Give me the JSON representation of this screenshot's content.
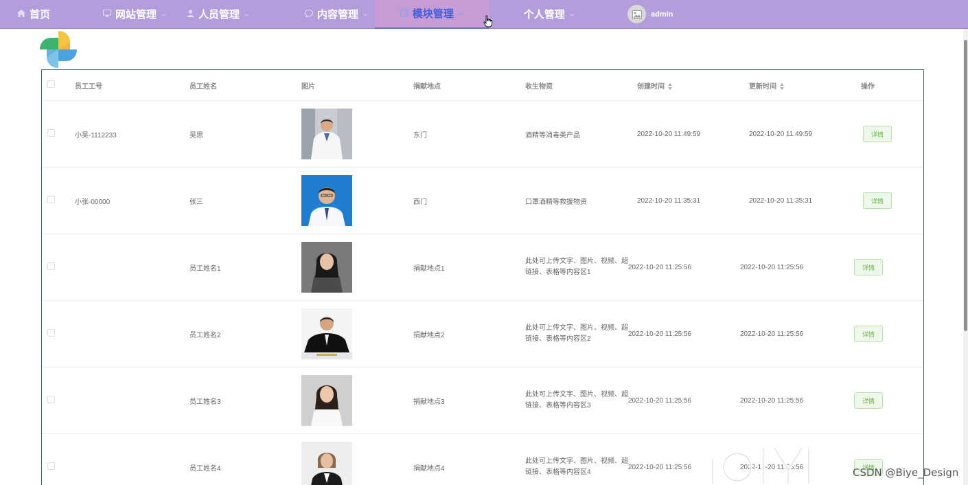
{
  "nav": {
    "items": [
      {
        "label": "首页",
        "icon": "home-icon",
        "dropdown": false
      },
      {
        "label": "网站管理",
        "icon": "monitor-icon",
        "dropdown": true
      },
      {
        "label": "人员管理",
        "icon": "user-icon",
        "dropdown": true
      },
      {
        "label": "内容管理",
        "icon": "chat-icon",
        "dropdown": true
      },
      {
        "label": "模块管理",
        "icon": "copy-icon",
        "dropdown": true,
        "active": true
      },
      {
        "label": "个人管理",
        "icon": "",
        "dropdown": true
      }
    ],
    "user": {
      "name": "admin",
      "icon": "image-icon"
    }
  },
  "table": {
    "headers": {
      "employee_id": "员工工号",
      "employee_name": "员工姓名",
      "photo": "图片",
      "location": "捐献地点",
      "supplies": "收生物资",
      "created": "创建时间",
      "updated": "更新时间",
      "actions": "操作"
    },
    "detail_label": "详情",
    "rows": [
      {
        "employee_id": "小吴-1112233",
        "employee_name": "吴思",
        "location": "东门",
        "supplies": "酒精等消毒类产品",
        "created": "2022-10-20 11:49:59",
        "updated": "2022-10-20 11:49:59"
      },
      {
        "employee_id": "小张-00000",
        "employee_name": "张三",
        "location": "西门",
        "supplies": "口罩酒精等救援物资",
        "created": "2022-10-20 11:35:31",
        "updated": "2022-10-20 11:35:31"
      },
      {
        "employee_id": "",
        "employee_name": "员工姓名1",
        "location": "捐献地点1",
        "supplies": "此处可上传文字、图片、视频、超链接、表格等内容区1",
        "created": "2022-10-20 11:25:56",
        "updated": "2022-10-20 11:25:56"
      },
      {
        "employee_id": "",
        "employee_name": "员工姓名2",
        "location": "捐献地点2",
        "supplies": "此处可上传文字、图片、视频、超链接、表格等内容区2",
        "created": "2022-10-20 11:25:56",
        "updated": "2022-10-20 11:25:56"
      },
      {
        "employee_id": "",
        "employee_name": "员工姓名3",
        "location": "捐献地点3",
        "supplies": "此处可上传文字、图片、视频、超链接、表格等内容区3",
        "created": "2022-10-20 11:25:56",
        "updated": "2022-10-20 11:25:56"
      },
      {
        "employee_id": "",
        "employee_name": "员工姓名4",
        "location": "捐献地点4",
        "supplies": "此处可上传文字、图片、视频、超链接、表格等内容区4",
        "created": "2022-10-20 11:25:56",
        "updated": "2022-10-20 11:25:56"
      }
    ]
  },
  "watermarks": {
    "platform": "iQIYI",
    "csdn": "CSDN @Biye_Design"
  },
  "colors": {
    "nav_bg": "#b39ddb",
    "active_bg": "#c79bd6",
    "active_text": "#3f5fd9",
    "table_border": "#2f5f80",
    "detail_btn": "#67b14a"
  }
}
